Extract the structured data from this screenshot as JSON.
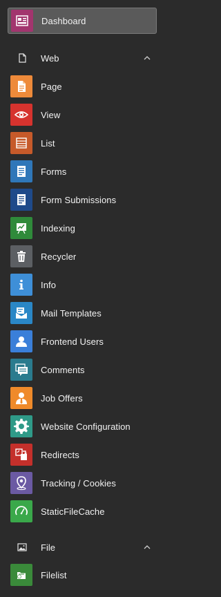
{
  "dashboard": {
    "label": "Dashboard",
    "icon": "dashboard-icon",
    "color": "#a2356e"
  },
  "groups": [
    {
      "label": "Web",
      "icon": "page-outline-icon",
      "expanded": true,
      "items": [
        {
          "label": "Page",
          "icon": "page-icon",
          "color": "#ee8a3a"
        },
        {
          "label": "View",
          "icon": "eye-icon",
          "color": "#d6332e"
        },
        {
          "label": "List",
          "icon": "list-icon",
          "color": "#c65a2a"
        },
        {
          "label": "Forms",
          "icon": "forms-icon",
          "color": "#2f77b9"
        },
        {
          "label": "Form Submissions",
          "icon": "form-submissions-icon",
          "color": "#1f4a8a"
        },
        {
          "label": "Indexing",
          "icon": "indexing-icon",
          "color": "#2f8a3a"
        },
        {
          "label": "Recycler",
          "icon": "trash-icon",
          "color": "#5c5f63"
        },
        {
          "label": "Info",
          "icon": "info-icon",
          "color": "#3e8fd8"
        },
        {
          "label": "Mail Templates",
          "icon": "mail-template-icon",
          "color": "#2a87c6"
        },
        {
          "label": "Frontend Users",
          "icon": "user-icon",
          "color": "#3a7fd9"
        },
        {
          "label": "Comments",
          "icon": "comments-icon",
          "color": "#2a7b8e"
        },
        {
          "label": "Job Offers",
          "icon": "job-offers-icon",
          "color": "#ef8a2a"
        },
        {
          "label": "Website Configuration",
          "icon": "gear-icon",
          "color": "#2f9a88"
        },
        {
          "label": "Redirects",
          "icon": "redirects-icon",
          "color": "#c4302b"
        },
        {
          "label": "Tracking / Cookies",
          "icon": "location-pin-icon",
          "color": "#6b5aa3"
        },
        {
          "label": "StaticFileCache",
          "icon": "gauge-icon",
          "color": "#3aa84a"
        }
      ]
    },
    {
      "label": "File",
      "icon": "image-icon",
      "expanded": true,
      "items": [
        {
          "label": "Filelist",
          "icon": "filelist-icon",
          "color": "#3a8a3a"
        }
      ]
    }
  ]
}
